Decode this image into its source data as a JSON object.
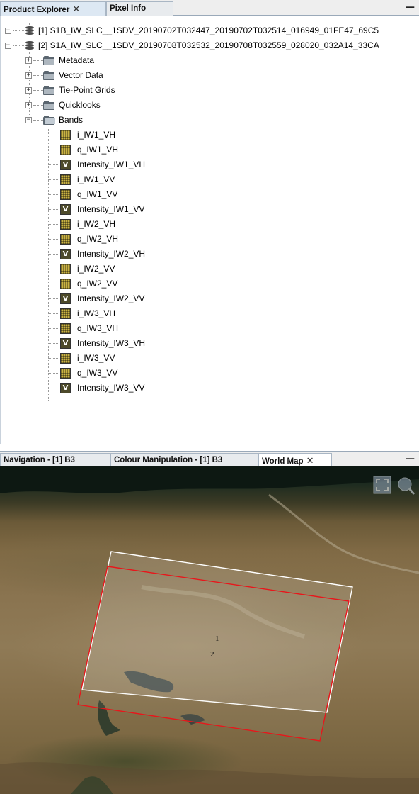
{
  "top_panel": {
    "tabs": [
      {
        "label": "Product Explorer",
        "close": "✕"
      },
      {
        "label": "Pixel Info"
      }
    ],
    "minimize": "—"
  },
  "tree": {
    "products": [
      {
        "label": "[1] S1B_IW_SLC__1SDV_20190702T032447_20190702T032514_016949_01FE47_69C5",
        "expander": "+"
      },
      {
        "label": "[2] S1A_IW_SLC__1SDV_20190708T032532_20190708T032559_028020_032A14_33CA",
        "expander": "−"
      }
    ],
    "groups": [
      {
        "label": "Metadata",
        "expander": "+"
      },
      {
        "label": "Vector Data",
        "expander": "+"
      },
      {
        "label": "Tie-Point Grids",
        "expander": "+"
      },
      {
        "label": "Quicklooks",
        "expander": "+"
      },
      {
        "label": "Bands",
        "expander": "−"
      }
    ],
    "bands": [
      {
        "label": "i_IW1_VH",
        "kind": "iq"
      },
      {
        "label": "q_IW1_VH",
        "kind": "iq"
      },
      {
        "label": "Intensity_IW1_VH",
        "kind": "virtual",
        "glyph": "V"
      },
      {
        "label": "i_IW1_VV",
        "kind": "iq"
      },
      {
        "label": "q_IW1_VV",
        "kind": "iq"
      },
      {
        "label": "Intensity_IW1_VV",
        "kind": "virtual",
        "glyph": "V"
      },
      {
        "label": "i_IW2_VH",
        "kind": "iq"
      },
      {
        "label": "q_IW2_VH",
        "kind": "iq"
      },
      {
        "label": "Intensity_IW2_VH",
        "kind": "virtual",
        "glyph": "V"
      },
      {
        "label": "i_IW2_VV",
        "kind": "iq"
      },
      {
        "label": "q_IW2_VV",
        "kind": "iq"
      },
      {
        "label": "Intensity_IW2_VV",
        "kind": "virtual",
        "glyph": "V"
      },
      {
        "label": "i_IW3_VH",
        "kind": "iq"
      },
      {
        "label": "q_IW3_VH",
        "kind": "iq"
      },
      {
        "label": "Intensity_IW3_VH",
        "kind": "virtual",
        "glyph": "V"
      },
      {
        "label": "i_IW3_VV",
        "kind": "iq"
      },
      {
        "label": "q_IW3_VV",
        "kind": "iq"
      },
      {
        "label": "Intensity_IW3_VV",
        "kind": "virtual",
        "glyph": "V"
      }
    ]
  },
  "bottom_panel": {
    "tabs": [
      {
        "label": "Navigation - [1] B3"
      },
      {
        "label": "Colour Manipulation - [1] B3"
      },
      {
        "label": "World Map",
        "close": "✕"
      }
    ],
    "minimize": "—"
  },
  "world_map": {
    "footprints": [
      {
        "label": "1",
        "color": "#ffffff"
      },
      {
        "label": "2",
        "color": "#e8161b"
      }
    ]
  }
}
